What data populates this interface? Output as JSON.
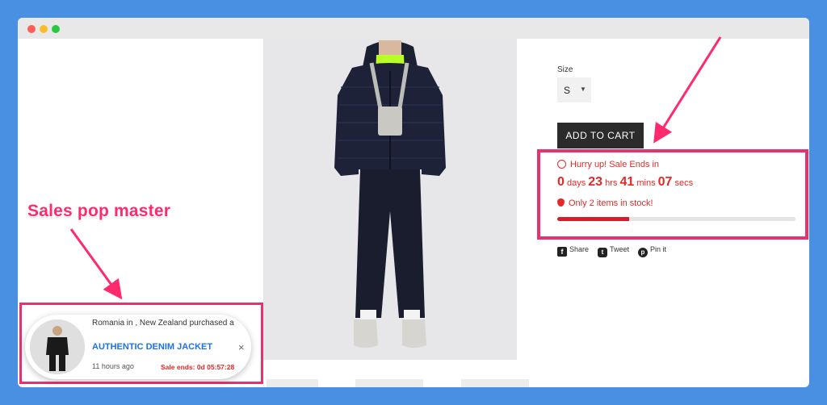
{
  "product": {
    "size_label": "Size",
    "size_value": "S",
    "add_to_cart": "ADD TO CART"
  },
  "sale": {
    "hurry_text": "Hurry up! Sale Ends in",
    "days": "0",
    "days_label": "days",
    "hours": "23",
    "hours_label": "hrs",
    "mins": "41",
    "mins_label": "mins",
    "secs": "07",
    "secs_label": "secs",
    "stock_text": "Only 2 items in stock!",
    "stock_progress": 0.3
  },
  "share": {
    "facebook": "Share",
    "twitter": "Tweet",
    "pinterest": "Pin it"
  },
  "annotation": {
    "label": "Sales pop master"
  },
  "popup": {
    "line": "Romania in , New Zealand purchased a",
    "product": "AUTHENTIC DENIM JACKET",
    "close": "×",
    "time": "11 hours ago",
    "sale_ends": "Sale ends: 0d 05:57:28"
  },
  "icons": {
    "timer": "stopwatch-icon",
    "stock": "drop-icon",
    "facebook": "facebook-icon",
    "twitter": "twitter-icon",
    "pinterest": "pinterest-icon"
  },
  "colors": {
    "accent_pink": "#e6326e",
    "sale_red": "#e02b27",
    "link_blue": "#1a73e8"
  }
}
